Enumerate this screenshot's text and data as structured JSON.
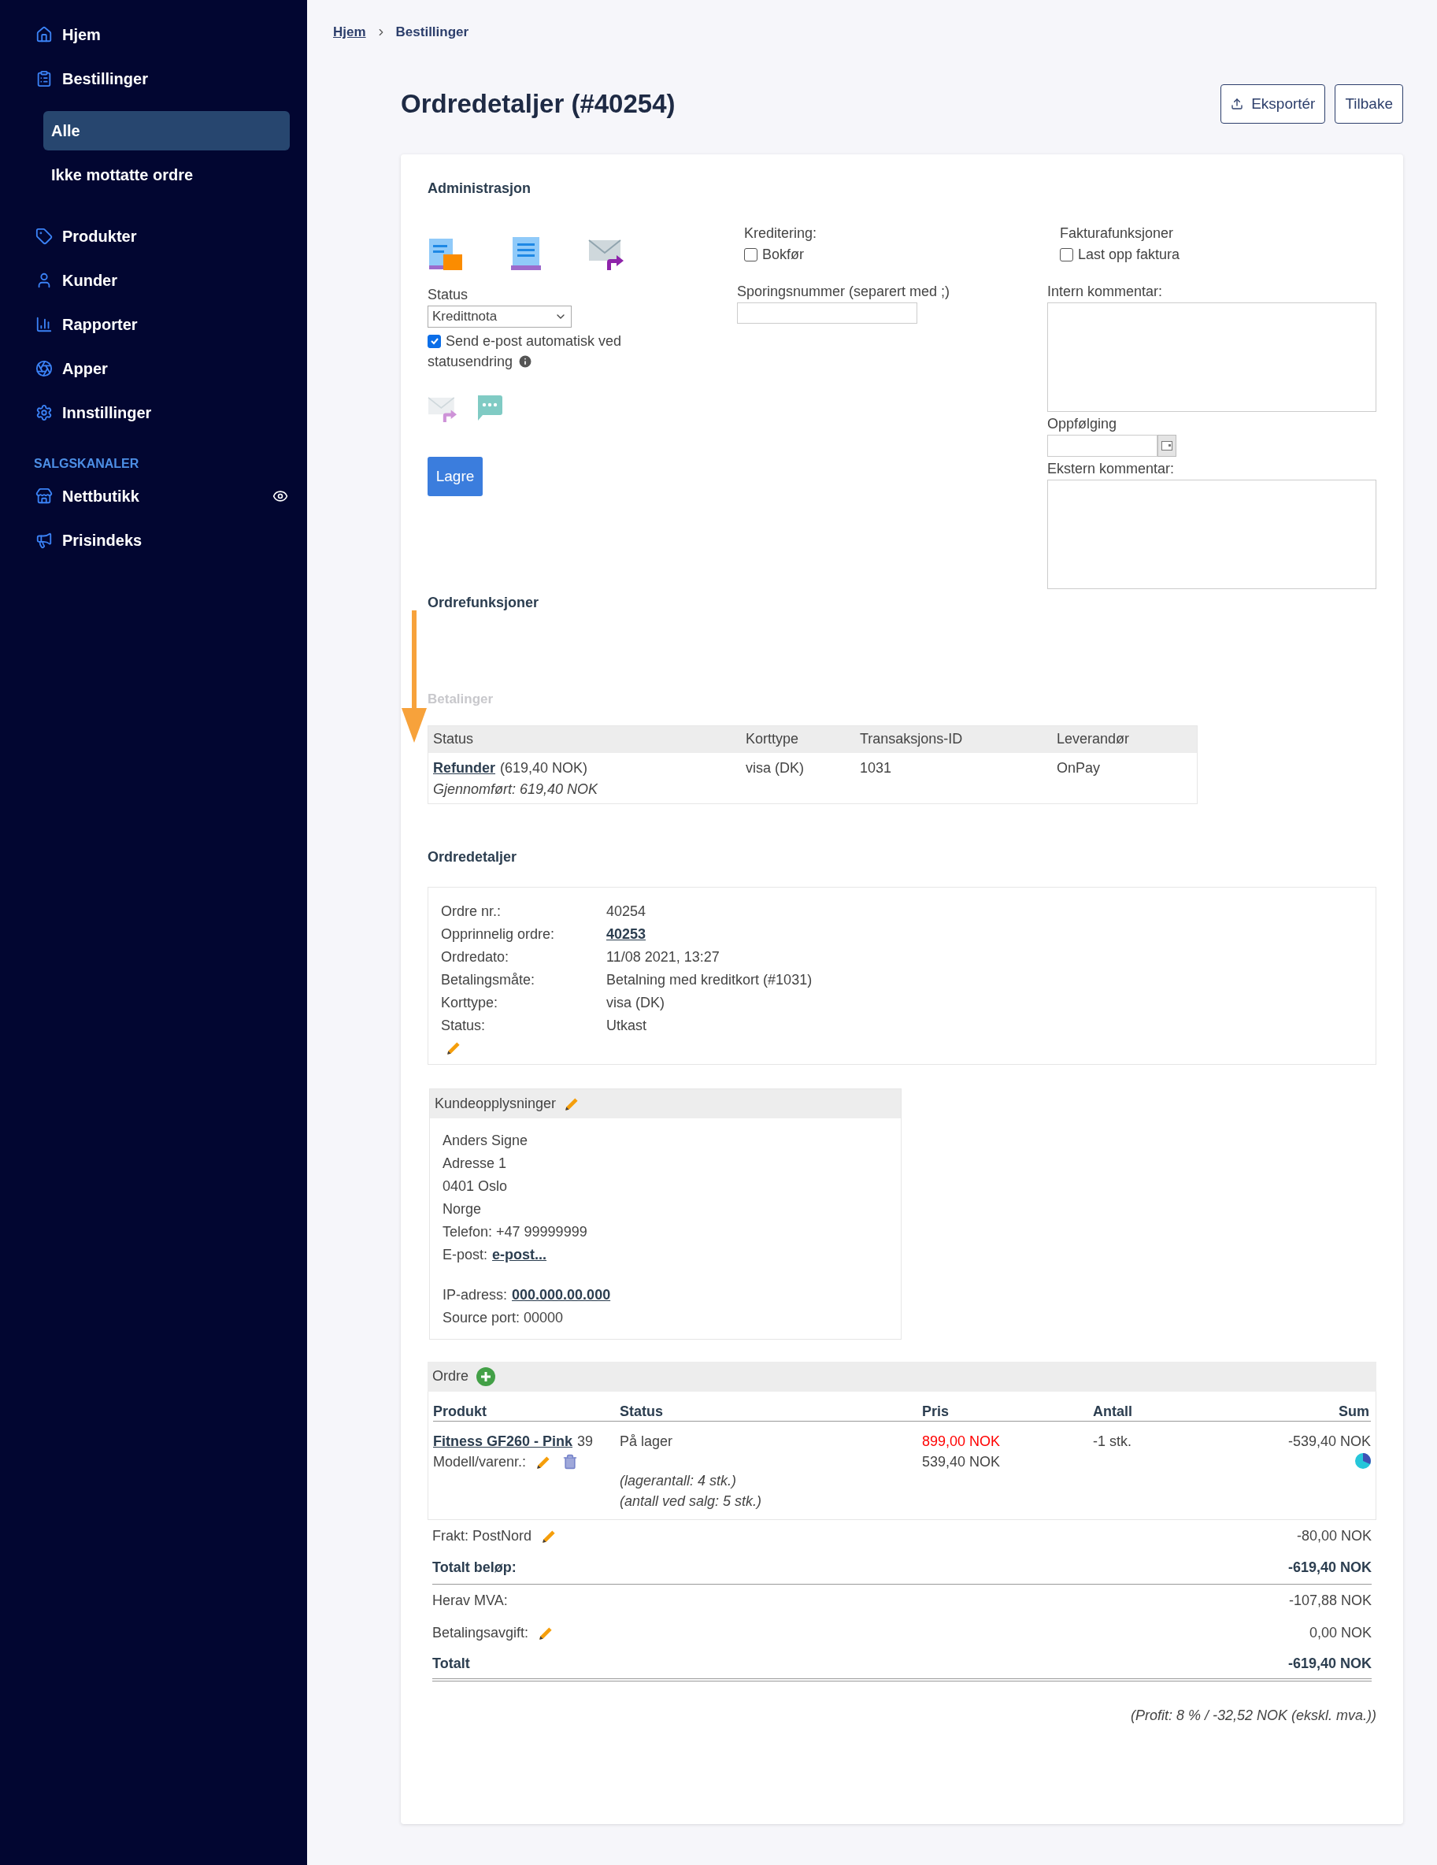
{
  "sidebar": {
    "items": [
      {
        "label": "Hjem",
        "selected": false
      },
      {
        "label": "Bestillinger",
        "selected": false,
        "children": [
          {
            "label": "Alle",
            "selected": true
          },
          {
            "label": "Ikke mottatte ordre",
            "selected": false
          }
        ]
      },
      {
        "label": "Produkter",
        "selected": false
      },
      {
        "label": "Kunder",
        "selected": false
      },
      {
        "label": "Rapporter",
        "selected": false
      },
      {
        "label": "Apper",
        "selected": false
      },
      {
        "label": "Innstillinger",
        "selected": false
      }
    ],
    "section_title": "SALGSKANALER",
    "channel_items": [
      {
        "label": "Nettbutikk",
        "selected": false,
        "previewable": true
      },
      {
        "label": "Prisindeks",
        "selected": false,
        "previewable": false
      }
    ]
  },
  "breadcrumbs": [
    {
      "label": "Hjem",
      "kind": "link"
    },
    {
      "label": "Bestillinger",
      "kind": "current"
    }
  ],
  "page_title": "Ordredetaljer (#40254)",
  "header_buttons": [
    {
      "label": "Eksportér",
      "kind": "export"
    },
    {
      "label": "Tilbake",
      "kind": "plain"
    }
  ],
  "administration": {
    "title": "Administrasjon",
    "status_label": "Status",
    "status_value": "Kredittnota",
    "send_email": {
      "label": "Send e-post automatisk ved",
      "label_continued": "statusendring",
      "checked": true
    },
    "crediting": {
      "label": "Kreditering:",
      "option": {
        "label": "Bokfør",
        "checked": false
      }
    },
    "invoice": {
      "label": "Fakturafunksjoner",
      "option": {
        "label": "Last opp faktura",
        "checked": false
      }
    },
    "tracking_label": "Sporingsnummer (separert med ;)",
    "internal_comment_label": "Intern kommentar:",
    "followup_label": "Oppfølging",
    "external_comment_label": "Ekstern kommentar:",
    "save_button": "Lagre"
  },
  "order_functions": {
    "title": "Ordrefunksjoner"
  },
  "payments": {
    "title": "Betalinger",
    "columns": [
      "Status",
      "Korttype",
      "Transaksjons-ID",
      "Leverandør"
    ],
    "rows": [
      {
        "action": "Refunder",
        "amount": "(619,40 NOK)",
        "note": "Gjennomført: 619,40 NOK",
        "card_type": "visa (DK)",
        "transaction_id": "1031",
        "provider": "OnPay"
      }
    ]
  },
  "order_details": {
    "title": "Ordredetaljer",
    "fields": [
      {
        "label": "Ordre nr.:",
        "value": "40254",
        "kind": "text"
      },
      {
        "label": "Opprinnelig ordre:",
        "value": "40253",
        "kind": "link"
      },
      {
        "label": "Ordredato:",
        "value": "11/08 2021, 13:27",
        "kind": "text"
      },
      {
        "label": "Betalingsmåte:",
        "value": "Betalning med kreditkort (#1031)",
        "kind": "text"
      },
      {
        "label": "Korttype:",
        "value": "visa (DK)",
        "kind": "text"
      },
      {
        "label": "Status:",
        "value": "Utkast",
        "kind": "text"
      }
    ]
  },
  "customer": {
    "title": "Kundeopplysninger",
    "lines": [
      "Anders Signe",
      "Adresse 1",
      "0401 Oslo",
      "Norge",
      "Telefon: +47 99999999"
    ],
    "email_label": "E-post:",
    "email_link": "e-post...",
    "ip_label": "IP-adress:",
    "ip_link": "000.000.00.000",
    "source_port": "Source port: 00000"
  },
  "order": {
    "title": "Ordre",
    "columns": [
      "Produkt",
      "Status",
      "Pris",
      "Antall",
      "Sum"
    ],
    "rows": [
      {
        "product": "Fitness GF260 - Pink",
        "product_suffix": "39",
        "model_label": "Modell/varenr.:",
        "status": "På lager",
        "stock_notes": [
          "(lagerantall: 4 stk.)",
          "(antall ved salg: 5 stk.)"
        ],
        "original_price": "899,00 NOK",
        "price": "539,40 NOK",
        "quantity": "-1 stk.",
        "sum": "-539,40 NOK"
      }
    ],
    "totals": [
      {
        "label": "Frakt: PostNord",
        "value": "-80,00 NOK",
        "kind": "editable"
      },
      {
        "label": "Totalt beløp:",
        "value": "-619,40 NOK",
        "kind": "total"
      },
      {
        "label": "Herav MVA:",
        "value": "-107,88 NOK",
        "kind": "plain"
      },
      {
        "label": "Betalingsavgift:",
        "value": "0,00 NOK",
        "kind": "editable"
      },
      {
        "label": "Totalt",
        "value": "-619,40 NOK",
        "kind": "grand_total"
      }
    ],
    "profit_note": "(Profit: 8 % / -32,52 NOK (ekskl. mva.))"
  }
}
